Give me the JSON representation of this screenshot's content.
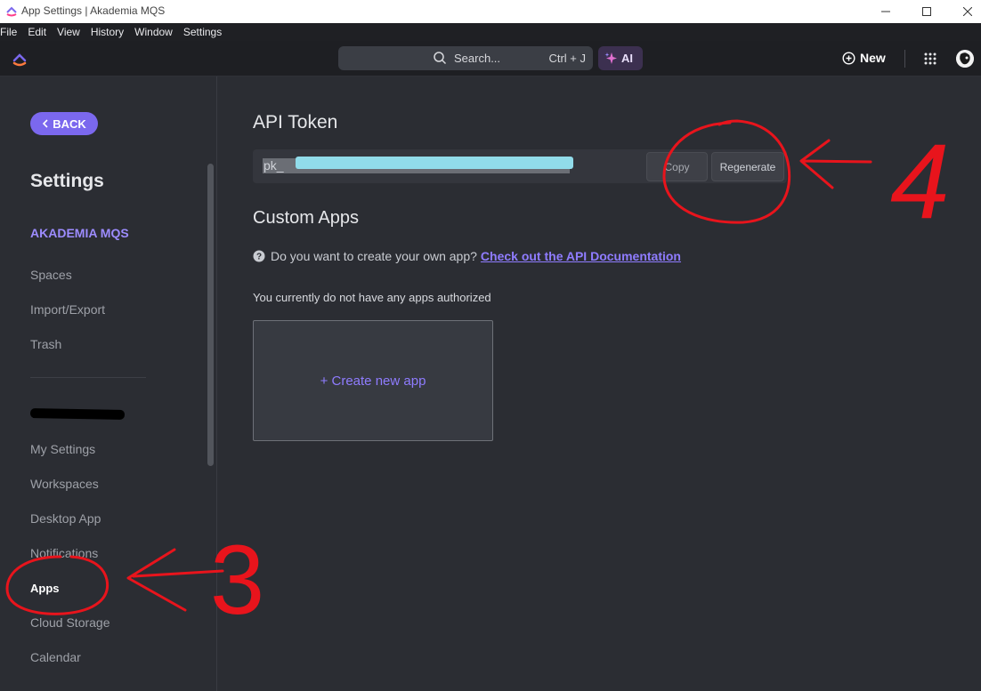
{
  "window": {
    "title": "App Settings | Akademia MQS"
  },
  "menu": [
    "File",
    "Edit",
    "View",
    "History",
    "Window",
    "Settings"
  ],
  "topbar": {
    "search_label": "Search...",
    "search_shortcut": "Ctrl + J",
    "ai_label": "AI",
    "new_label": "New"
  },
  "sidebar": {
    "back_label": "BACK",
    "title": "Settings",
    "workspace_name": "AKADEMIA MQS",
    "workspace_items": [
      "Spaces",
      "Import/Export",
      "Trash"
    ],
    "user_items": [
      "My Settings",
      "Workspaces",
      "Desktop App",
      "Notifications",
      "Apps",
      "Cloud Storage",
      "Calendar"
    ],
    "active_item": "Apps"
  },
  "main": {
    "api_heading": "API Token",
    "token_prefix": "pk_",
    "copy_label": "Copy",
    "regenerate_label": "Regenerate",
    "custom_heading": "Custom Apps",
    "help_text": "Do you want to create your own app?",
    "help_link": "Check out the API Documentation",
    "no_apps_text": "You currently do not have any apps authorized",
    "create_label": "+ Create new app"
  },
  "annotations": {
    "label_3": "3",
    "label_4": "4",
    "color": "#e8141c"
  },
  "colors": {
    "accent": "#7b68ee",
    "background": "#2b2d33"
  }
}
